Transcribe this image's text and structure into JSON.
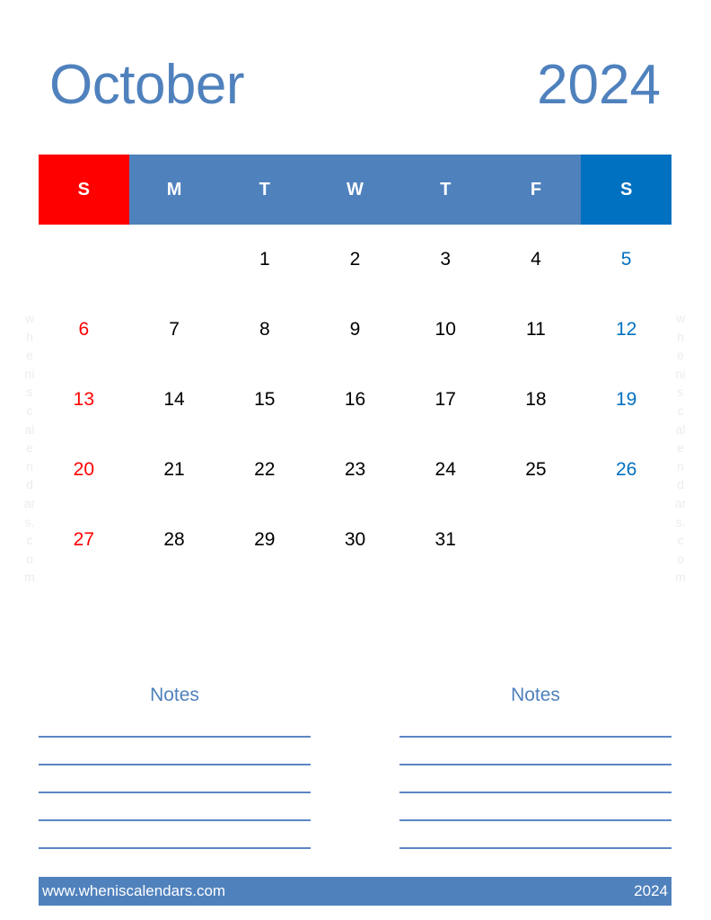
{
  "title": {
    "month": "October",
    "year": "2024"
  },
  "weekdays": [
    {
      "label": "S",
      "kind": "sun"
    },
    {
      "label": "M",
      "kind": ""
    },
    {
      "label": "T",
      "kind": ""
    },
    {
      "label": "W",
      "kind": ""
    },
    {
      "label": "T",
      "kind": ""
    },
    {
      "label": "F",
      "kind": ""
    },
    {
      "label": "S",
      "kind": "sat"
    }
  ],
  "weeks": [
    [
      "",
      "",
      "1",
      "2",
      "3",
      "4",
      "5"
    ],
    [
      "6",
      "7",
      "8",
      "9",
      "10",
      "11",
      "12"
    ],
    [
      "13",
      "14",
      "15",
      "16",
      "17",
      "18",
      "19"
    ],
    [
      "20",
      "21",
      "22",
      "23",
      "24",
      "25",
      "26"
    ],
    [
      "27",
      "28",
      "29",
      "30",
      "31",
      "",
      ""
    ]
  ],
  "watermark": [
    "w",
    "h",
    "e",
    "ni",
    "s",
    "c",
    "al",
    "e",
    "n",
    "d",
    "ar",
    "s.",
    "c",
    "o",
    "m"
  ],
  "notes": [
    {
      "title": "Notes",
      "line_count": 5
    },
    {
      "title": "Notes",
      "line_count": 5
    }
  ],
  "footer": {
    "website": "www.wheniscalendars.com",
    "year": "2024"
  },
  "colors": {
    "accent": "#4f81bd",
    "sunday": "#ff0000",
    "saturday": "#0070c0"
  }
}
